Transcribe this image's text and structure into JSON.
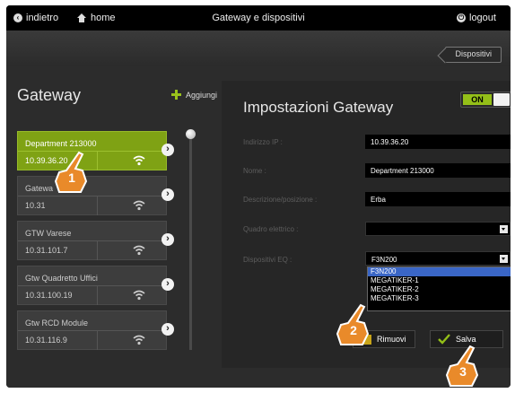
{
  "topbar": {
    "back_label": "indietro",
    "home_label": "home",
    "title": "Gateway e dispositivi",
    "logout_label": "logout"
  },
  "breadcrumb": {
    "current": "Dispositivi"
  },
  "gateway_list": {
    "title": "Gateway",
    "add_label": "Aggiungi",
    "items": [
      {
        "name": "Department 213000",
        "ip": "10.39.36.20"
      },
      {
        "name": "Gatewa",
        "ip": "10.31"
      },
      {
        "name": "GTW Varese",
        "ip": "10.31.101.7"
      },
      {
        "name": "Gtw Quadretto Uffici",
        "ip": "10.31.100.19"
      },
      {
        "name": "Gtw RCD Module",
        "ip": "10.31.116.9"
      }
    ]
  },
  "settings": {
    "title": "Impostazioni Gateway",
    "toggle_label": "ON",
    "fields": {
      "ip_label": "Indirizzo IP :",
      "ip_value": "10.39.36.20",
      "name_label": "Nome :",
      "name_value": "Department 213000",
      "desc_label": "Descrizione/posizione :",
      "desc_value": "Erba",
      "panel_label": "Quadro elettrico :",
      "panel_value": "",
      "devices_label": "Dispositivi EQ :",
      "devices_value": "F3N200"
    },
    "device_options": [
      "F3N200",
      "MEGATIKER-1",
      "MEGATIKER-2",
      "MEGATIKER-3"
    ],
    "remove_label": "Rimuovi",
    "save_label": "Salva"
  },
  "callouts": [
    "1",
    "2",
    "3"
  ],
  "colors": {
    "accent_green": "#94bf18",
    "selection_blue": "#3a66c6"
  }
}
